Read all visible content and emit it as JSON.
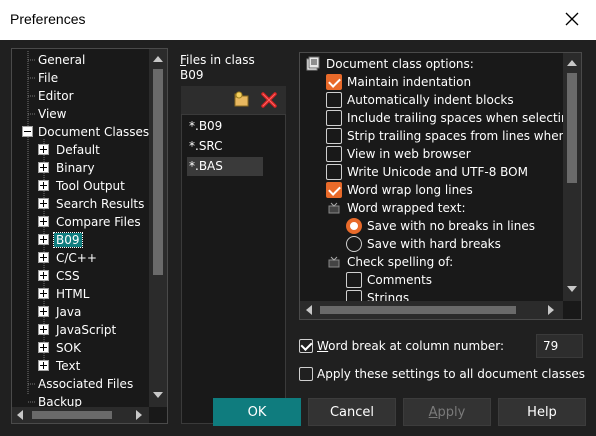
{
  "window": {
    "title": "Preferences"
  },
  "tree": {
    "items": [
      {
        "label": "General",
        "expander": "none",
        "selected": false
      },
      {
        "label": "File",
        "expander": "none",
        "selected": false
      },
      {
        "label": "Editor",
        "expander": "none",
        "selected": false
      },
      {
        "label": "View",
        "expander": "none",
        "selected": false
      },
      {
        "label": "Document Classes",
        "expander": "minus",
        "selected": false
      },
      {
        "label": "Default",
        "expander": "plus",
        "selected": false
      },
      {
        "label": "Binary",
        "expander": "plus",
        "selected": false
      },
      {
        "label": "Tool Output",
        "expander": "plus",
        "selected": false
      },
      {
        "label": "Search Results",
        "expander": "plus",
        "selected": false
      },
      {
        "label": "Compare Files",
        "expander": "plus",
        "selected": false
      },
      {
        "label": "B09",
        "expander": "plus",
        "selected": true
      },
      {
        "label": "C/C++",
        "expander": "plus",
        "selected": false
      },
      {
        "label": "CSS",
        "expander": "plus",
        "selected": false
      },
      {
        "label": "HTML",
        "expander": "plus",
        "selected": false
      },
      {
        "label": "Java",
        "expander": "plus",
        "selected": false
      },
      {
        "label": "JavaScript",
        "expander": "plus",
        "selected": false
      },
      {
        "label": "SOK",
        "expander": "plus",
        "selected": false
      },
      {
        "label": "Text",
        "expander": "plus",
        "selected": false
      },
      {
        "label": "Associated Files",
        "expander": "none",
        "selected": false
      },
      {
        "label": "Backup",
        "expander": "none",
        "selected": false
      }
    ]
  },
  "files": {
    "label_line1": "Files in class",
    "label_line2": "B09",
    "items": [
      "*.B09",
      "*.SRC",
      "*.BAS"
    ],
    "selected_index": 2
  },
  "options": {
    "header": "Document class options:",
    "items": [
      {
        "type": "checkbox",
        "label": "Maintain indentation",
        "checked": true
      },
      {
        "type": "checkbox",
        "label": "Automatically indent blocks",
        "checked": false
      },
      {
        "type": "checkbox",
        "label": "Include trailing spaces when selecting",
        "checked": false
      },
      {
        "type": "checkbox",
        "label": "Strip trailing spaces from lines when",
        "checked": false
      },
      {
        "type": "checkbox",
        "label": "View in web browser",
        "checked": false
      },
      {
        "type": "checkbox",
        "label": "Write Unicode and UTF-8 BOM",
        "checked": false
      },
      {
        "type": "checkbox",
        "label": "Word wrap long lines",
        "checked": true
      },
      {
        "type": "group",
        "label": "Word wrapped text:"
      },
      {
        "type": "radio",
        "label": "Save with no breaks in lines",
        "checked": true
      },
      {
        "type": "radio",
        "label": "Save with hard breaks",
        "checked": false
      },
      {
        "type": "group",
        "label": "Check spelling of:"
      },
      {
        "type": "checkbox-sub",
        "label": "Comments",
        "checked": false
      },
      {
        "type": "checkbox-sub",
        "label": "Strings",
        "checked": false
      }
    ]
  },
  "word_break": {
    "label": "Word break at column number:",
    "checked": true,
    "value": "79"
  },
  "apply_all": {
    "label": "Apply these settings to all document classes",
    "checked": false
  },
  "buttons": {
    "ok": "OK",
    "cancel": "Cancel",
    "apply": "Apply",
    "help": "Help"
  },
  "colors": {
    "accent": "#0f7c7e",
    "check": "#e86a2a"
  }
}
